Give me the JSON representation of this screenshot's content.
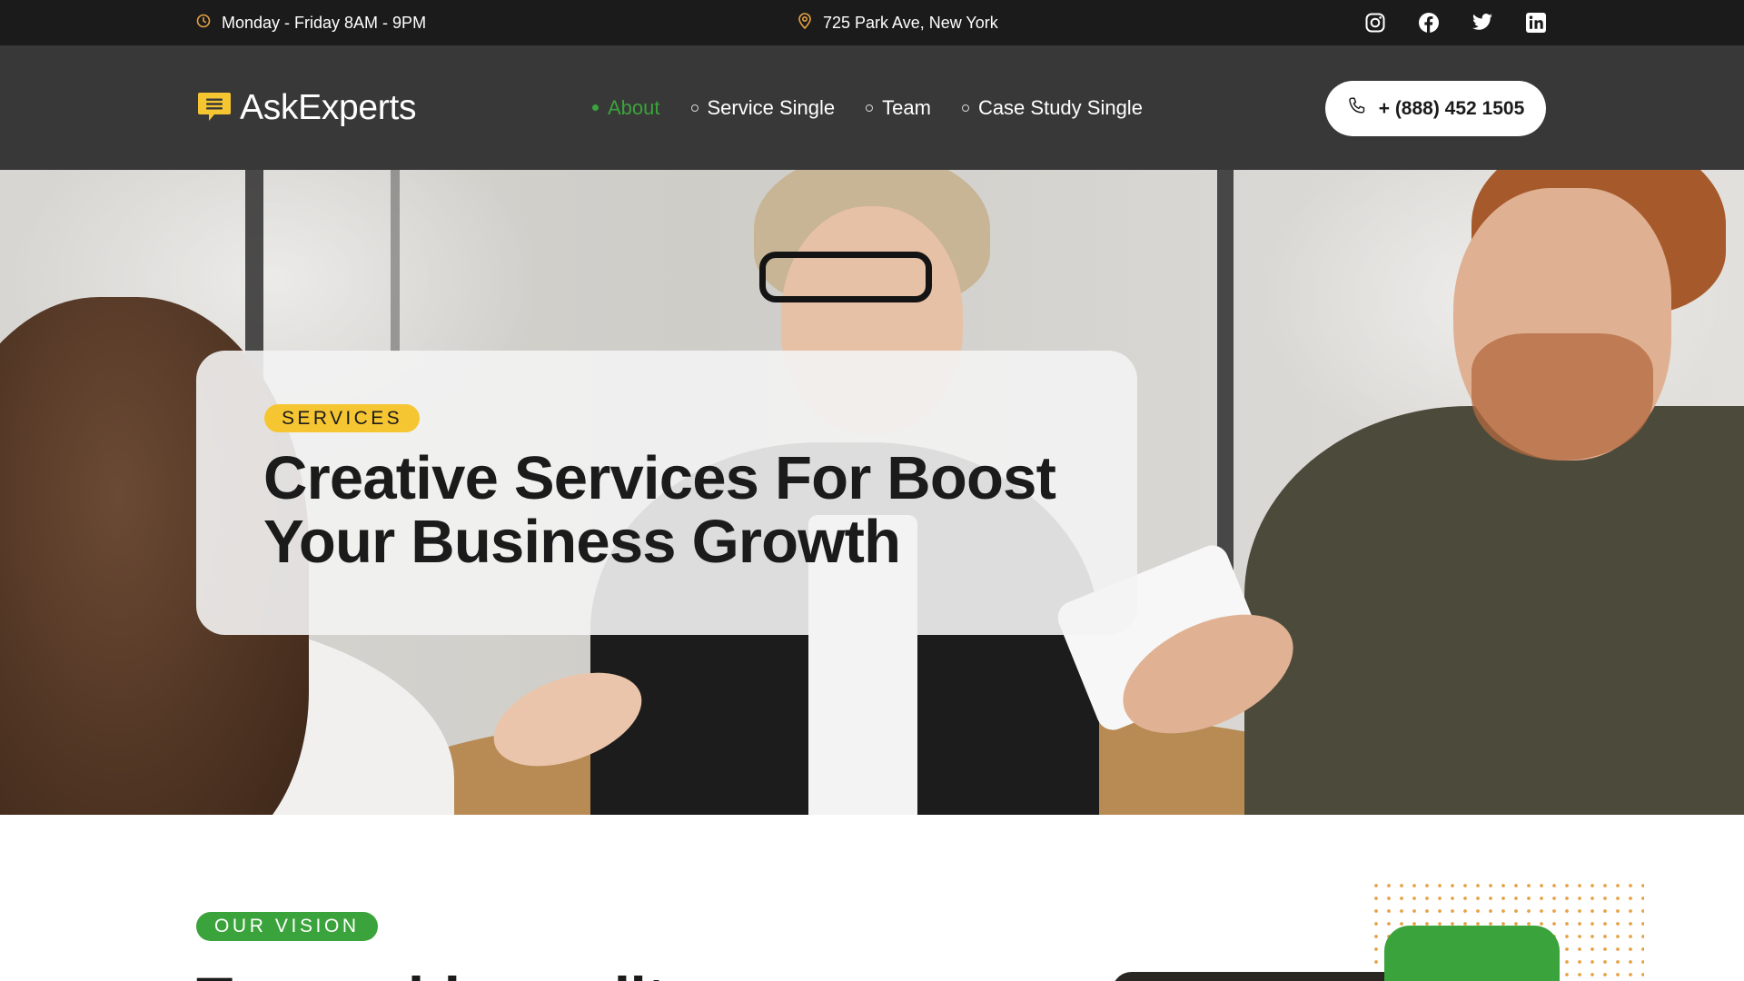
{
  "topbar": {
    "hours": "Monday - Friday 8AM - 9PM",
    "address": "725 Park Ave, New York",
    "socials": [
      "instagram-icon",
      "facebook-icon",
      "twitter-icon",
      "linkedin-icon"
    ]
  },
  "header": {
    "logo_text": "AskExperts",
    "nav": [
      {
        "label": "About",
        "active": true
      },
      {
        "label": "Service Single",
        "active": false
      },
      {
        "label": "Team",
        "active": false
      },
      {
        "label": "Case Study Single",
        "active": false
      }
    ],
    "phone": "+ (888) 452 1505"
  },
  "hero": {
    "badge": "SERVICES",
    "title_line1": "Creative Services For Boost",
    "title_line2": "Your Business Growth"
  },
  "vision": {
    "badge": "OUR VISION",
    "heading": "To provide quality"
  },
  "colors": {
    "accent_green": "#3ba33b",
    "accent_yellow": "#f6c632",
    "icon_orange": "#e6a244",
    "topbar_bg": "#1b1b1b",
    "header_bg": "#383838"
  }
}
